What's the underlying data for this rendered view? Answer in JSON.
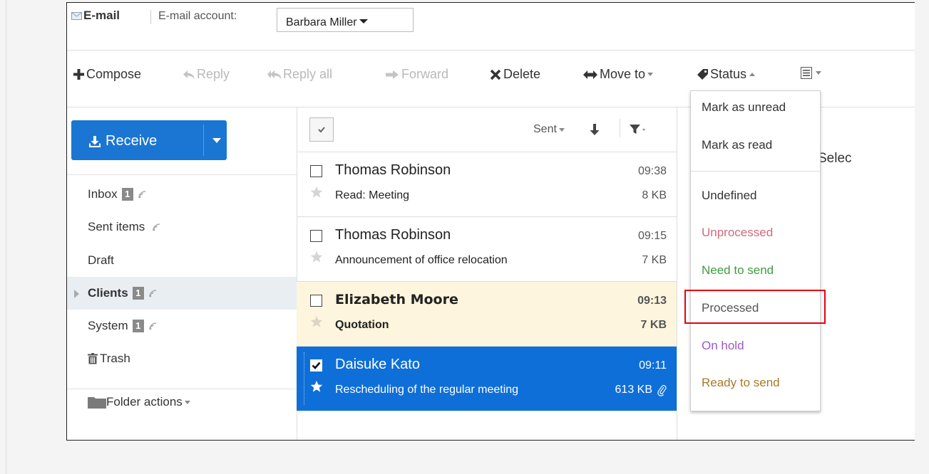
{
  "header": {
    "title": "E-mail",
    "account_label": "E-mail account:",
    "account_value": "Barbara Miller"
  },
  "toolbar": {
    "compose": "Compose",
    "reply": "Reply",
    "reply_all": "Reply all",
    "forward": "Forward",
    "delete": "Delete",
    "move_to": "Move to",
    "status": "Status"
  },
  "sidebar": {
    "receive": "Receive",
    "folders": [
      {
        "label": "Inbox",
        "badge": "1"
      },
      {
        "label": "Sent items"
      },
      {
        "label": "Draft"
      },
      {
        "label": "Clients",
        "badge": "1"
      },
      {
        "label": "System",
        "badge": "1"
      },
      {
        "label": "Trash"
      }
    ],
    "folder_actions": "Folder actions"
  },
  "list": {
    "sort_label": "Sent",
    "messages": [
      {
        "from": "Thomas Robinson",
        "time": "09:38",
        "subject": "Read: Meeting",
        "size": "8 KB"
      },
      {
        "from": "Thomas Robinson",
        "time": "09:15",
        "subject": "Announcement of office relocation",
        "size": "7 KB"
      },
      {
        "from": "Elizabeth Moore",
        "time": "09:13",
        "subject": "Quotation",
        "size": "7 KB"
      },
      {
        "from": "Daisuke Kato",
        "time": "09:11",
        "subject": "Rescheduling of the regular meeting",
        "size": "613 KB"
      }
    ]
  },
  "preview": {
    "text": "Selec"
  },
  "status_menu": {
    "items": [
      {
        "label": "Mark as unread",
        "color": "#333333"
      },
      {
        "label": "Mark as read",
        "color": "#333333"
      },
      {
        "label": "Undefined",
        "color": "#333333"
      },
      {
        "label": "Unprocessed",
        "color": "#d2697a"
      },
      {
        "label": "Need to send",
        "color": "#3e9c3e"
      },
      {
        "label": "Processed",
        "color": "#555555"
      },
      {
        "label": "On hold",
        "color": "#9b59c6"
      },
      {
        "label": "Ready to send",
        "color": "#a8792a"
      }
    ]
  },
  "colors": {
    "accent": "#1a76d2",
    "selected_row": "#0f6fd8",
    "unread_row": "#fdf5de",
    "highlight_box": "#e60012"
  }
}
